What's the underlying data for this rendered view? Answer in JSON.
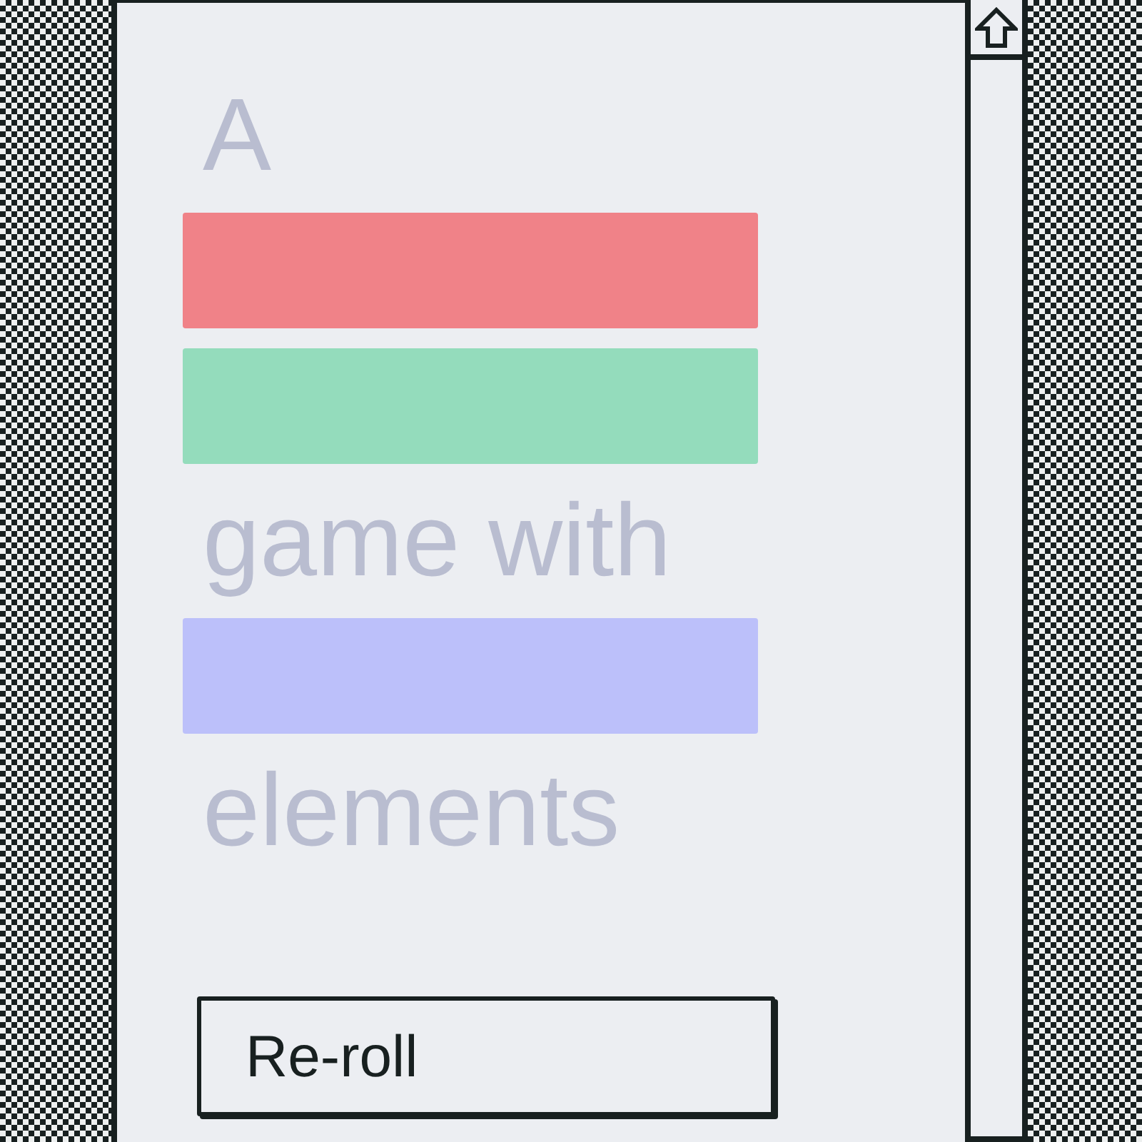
{
  "phrase": [
    {
      "kind": "word",
      "text": "A"
    },
    {
      "kind": "blank",
      "color": "#f08288"
    },
    {
      "kind": "blank",
      "color": "#94dcbc"
    },
    {
      "kind": "word",
      "text": "game with"
    },
    {
      "kind": "blank",
      "color": "#bcc0fa"
    },
    {
      "kind": "word",
      "text": "elements"
    }
  ],
  "button": {
    "label": "Re-roll"
  }
}
